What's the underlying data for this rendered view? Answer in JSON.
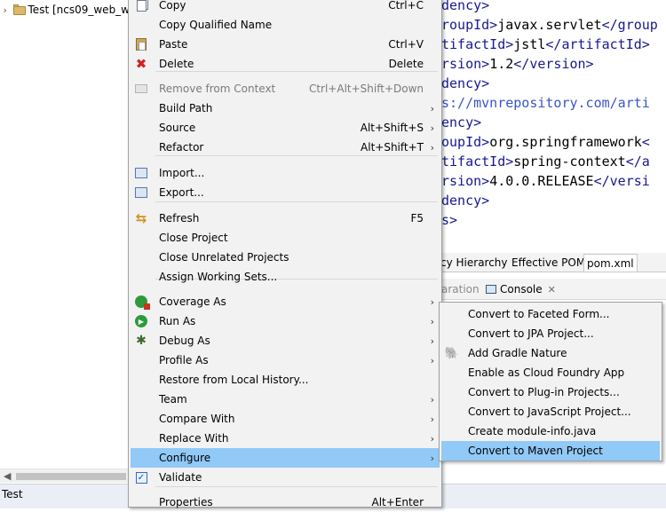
{
  "explorer": {
    "project_label": "Test [ncs09_web_w",
    "status_text": "Test"
  },
  "editor": {
    "lines": [
      {
        "parts": [
          [
            "tag",
            "dency>"
          ]
        ]
      },
      {
        "parts": [
          [
            "tag",
            "roupId>"
          ],
          [
            "txt",
            "javax.servlet"
          ],
          [
            "tag",
            "</group"
          ]
        ]
      },
      {
        "parts": [
          [
            "tag",
            "tifactId>"
          ],
          [
            "txt",
            "jstl"
          ],
          [
            "tag",
            "</artifactId>"
          ]
        ]
      },
      {
        "parts": [
          [
            "tag",
            "rsion>"
          ],
          [
            "txt",
            "1.2"
          ],
          [
            "tag",
            "</version>"
          ]
        ]
      },
      {
        "parts": [
          [
            "tag",
            "dency>"
          ]
        ]
      },
      {
        "parts": [
          [
            "url",
            "s://mvnrepository.com/arti"
          ]
        ]
      },
      {
        "parts": [
          [
            "tag",
            "ency>"
          ]
        ]
      },
      {
        "parts": [
          [
            "tag",
            "oupId>"
          ],
          [
            "txt",
            "org.springframework"
          ],
          [
            "tag",
            "<"
          ]
        ]
      },
      {
        "parts": [
          [
            "tag",
            "tifactId>"
          ],
          [
            "txt",
            "spring-context"
          ],
          [
            "tag",
            "</a"
          ]
        ]
      },
      {
        "parts": [
          [
            "tag",
            "rsion>"
          ],
          [
            "txt",
            "4.0.0.RELEASE"
          ],
          [
            "tag",
            "</versi"
          ]
        ]
      },
      {
        "parts": [
          [
            "tag",
            "dency>"
          ]
        ]
      },
      {
        "parts": [
          [
            "tag",
            "s>"
          ]
        ]
      }
    ],
    "tabs": [
      "cy Hierarchy",
      "Effective POM",
      "pom.xml"
    ],
    "views": {
      "declaration_partial": "aration",
      "console": "Console"
    }
  },
  "context_menu": {
    "items": [
      {
        "name": "copy",
        "label": "Copy",
        "shortcut": "Ctrl+C",
        "icon": "copy-icon"
      },
      {
        "name": "copy-qualified-name",
        "label": "Copy Qualified Name",
        "shortcut": "",
        "icon": ""
      },
      {
        "name": "paste",
        "label": "Paste",
        "shortcut": "Ctrl+V",
        "icon": "paste-icon"
      },
      {
        "name": "delete",
        "label": "Delete",
        "shortcut": "Delete",
        "icon": "delete-icon"
      },
      {
        "name": "remove-from-context",
        "label": "Remove from Context",
        "shortcut": "Ctrl+Alt+Shift+Down",
        "icon": "remove-from-context-icon",
        "disabled": true
      },
      {
        "name": "build-path",
        "label": "Build Path",
        "shortcut": "",
        "submenu": true
      },
      {
        "name": "source",
        "label": "Source",
        "shortcut": "Alt+Shift+S",
        "submenu": true
      },
      {
        "name": "refactor",
        "label": "Refactor",
        "shortcut": "Alt+Shift+T",
        "submenu": true
      },
      {
        "name": "import",
        "label": "Import...",
        "shortcut": "",
        "icon": "import-icon"
      },
      {
        "name": "export",
        "label": "Export...",
        "shortcut": "",
        "icon": "export-icon"
      },
      {
        "name": "refresh",
        "label": "Refresh",
        "shortcut": "F5",
        "icon": "refresh-icon"
      },
      {
        "name": "close-project",
        "label": "Close Project",
        "shortcut": ""
      },
      {
        "name": "close-unrelated-projects",
        "label": "Close Unrelated Projects",
        "shortcut": ""
      },
      {
        "name": "assign-working-sets",
        "label": "Assign Working Sets...",
        "shortcut": ""
      },
      {
        "name": "coverage-as",
        "label": "Coverage As",
        "shortcut": "",
        "icon": "coverage-icon",
        "submenu": true
      },
      {
        "name": "run-as",
        "label": "Run As",
        "shortcut": "",
        "icon": "run-icon",
        "submenu": true
      },
      {
        "name": "debug-as",
        "label": "Debug As",
        "shortcut": "",
        "icon": "debug-bug-icon",
        "submenu": true
      },
      {
        "name": "profile-as",
        "label": "Profile As",
        "shortcut": "",
        "submenu": true
      },
      {
        "name": "restore-from-local-history",
        "label": "Restore from Local History...",
        "shortcut": ""
      },
      {
        "name": "team",
        "label": "Team",
        "shortcut": "",
        "submenu": true
      },
      {
        "name": "compare-with",
        "label": "Compare With",
        "shortcut": "",
        "submenu": true
      },
      {
        "name": "replace-with",
        "label": "Replace With",
        "shortcut": "",
        "submenu": true
      },
      {
        "name": "configure",
        "label": "Configure",
        "shortcut": "",
        "submenu": true,
        "selected": true
      },
      {
        "name": "validate",
        "label": "Validate",
        "shortcut": "",
        "icon": "validate-check-icon"
      },
      {
        "name": "properties",
        "label": "Properties",
        "shortcut": "Alt+Enter"
      }
    ]
  },
  "submenu": {
    "items": [
      {
        "name": "convert-to-faceted-form",
        "label": "Convert to Faceted Form..."
      },
      {
        "name": "convert-to-jpa-project",
        "label": "Convert to JPA Project..."
      },
      {
        "name": "add-gradle-nature",
        "label": "Add Gradle Nature",
        "icon": "gradle-elephant-icon"
      },
      {
        "name": "enable-cloud-foundry-app",
        "label": "Enable as Cloud Foundry App"
      },
      {
        "name": "convert-to-plugin-projects",
        "label": "Convert to Plug-in Projects..."
      },
      {
        "name": "convert-to-javascript-project",
        "label": "Convert to JavaScript Project..."
      },
      {
        "name": "create-module-info",
        "label": "Create module-info.java"
      },
      {
        "name": "convert-to-maven-project",
        "label": "Convert to Maven Project",
        "selected": true
      }
    ]
  },
  "colors": {
    "selection": "#91c9f7",
    "menu_bg": "#f2f2f2",
    "xml_tag": "#17198c",
    "status_bar": "#ebeef6"
  }
}
